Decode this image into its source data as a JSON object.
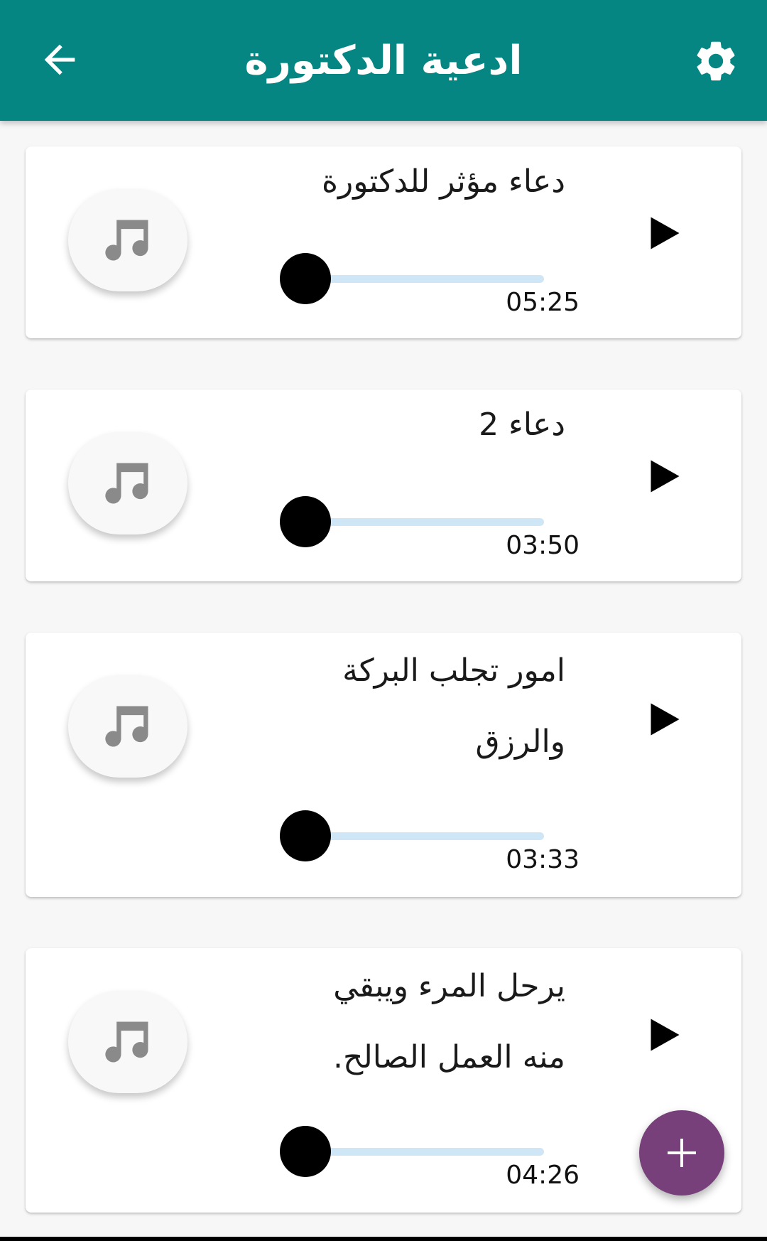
{
  "app_bar": {
    "title": "ادعية الدكتورة",
    "back_icon": "arrow-back-icon",
    "settings_icon": "gear-icon",
    "color": "#068683"
  },
  "tracks": [
    {
      "title": "دعاء مؤثر للدكتورة",
      "duration": "05:25",
      "progress": 0
    },
    {
      "title": "دعاء 2",
      "duration": "03:50",
      "progress": 0
    },
    {
      "title": "امور تجلب البركة\nوالرزق",
      "duration": "03:33",
      "progress": 0
    },
    {
      "title": "يرحل المرء ويبقي\nمنه العمل الصالح.",
      "duration": "04:26",
      "progress": 0
    }
  ],
  "icons": {
    "thumbnail": "music-note-icon",
    "play": "play-icon",
    "fab": "plus-icon"
  },
  "colors": {
    "fab": "#77407a",
    "slider_rail": "#cfe6f7",
    "slider_knob": "#000000"
  }
}
